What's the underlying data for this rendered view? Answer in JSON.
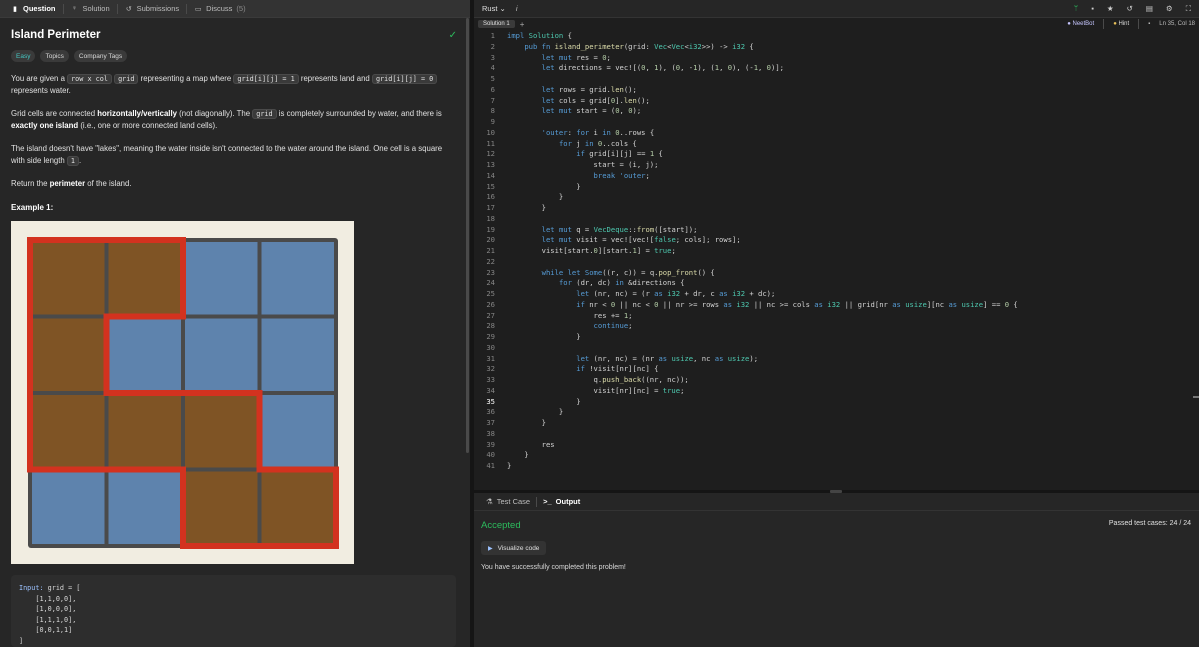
{
  "left_tabs": [
    {
      "label": "Question",
      "icon": "question-icon"
    },
    {
      "label": "Solution",
      "icon": "bulb-icon"
    },
    {
      "label": "Submissions",
      "icon": "history-icon"
    },
    {
      "label": "Discuss",
      "icon": "chat-icon",
      "count": "(5)"
    }
  ],
  "problem": {
    "title": "Island Perimeter",
    "tags": [
      "Easy",
      "Topics",
      "Company Tags"
    ],
    "p1_a": "You are given a ",
    "p1_code1": "row x col",
    "p1_b": " ",
    "p1_code2": "grid",
    "p1_c": " representing a map where ",
    "p1_code3": "grid[i][j] = 1",
    "p1_d": " represents land and ",
    "p1_code4": "grid[i][j] = 0",
    "p1_e": " represents water.",
    "p2_a": "Grid cells are connected ",
    "p2_b": "horizontally/vertically",
    "p2_c": " (not diagonally). The ",
    "p2_code": "grid",
    "p2_d": " is completely surrounded by water, and there is ",
    "p2_e": "exactly one island",
    "p2_f": " (i.e., one or more connected land cells).",
    "p3_a": "The island doesn't have \"lakes\", meaning the water inside isn't connected to the water around the island. One cell is a square with side length ",
    "p3_code": "1",
    "p3_b": ".",
    "p4_a": "Return the ",
    "p4_b": "perimeter",
    "p4_c": " of the island.",
    "example_title": "Example 1:",
    "grid": [
      [
        1,
        1,
        0,
        0
      ],
      [
        1,
        0,
        0,
        0
      ],
      [
        1,
        1,
        1,
        0
      ],
      [
        0,
        0,
        1,
        1
      ]
    ],
    "input_label": "Input:",
    "input_text": " grid = [\n    [1,1,0,0],\n    [1,0,0,0],\n    [1,1,1,0],\n    [0,0,1,1]\n]"
  },
  "colors": {
    "land": "#7f5425",
    "water": "#5e83ad",
    "border": "#d3321f",
    "grid_line": "#4a4a4a",
    "accepted": "#2cbb5d"
  },
  "editor": {
    "language": "Rust",
    "info_icon": "i",
    "file_tab": "Solution 1",
    "neetbot": "NeetBot",
    "hint": "Hint",
    "cursor": "Ln 35, Col 18",
    "current_line": 35,
    "lines": [
      "impl Solution {",
      "    pub fn island_perimeter(grid: Vec<Vec<i32>>) -> i32 {",
      "        let mut res = 0;",
      "        let directions = vec![(0, 1), (0, -1), (1, 0), (-1, 0)];",
      "",
      "        let rows = grid.len();",
      "        let cols = grid[0].len();",
      "        let mut start = (0, 0);",
      "",
      "        'outer: for i in 0..rows {",
      "            for j in 0..cols {",
      "                if grid[i][j] == 1 {",
      "                    start = (i, j);",
      "                    break 'outer;",
      "                }",
      "            }",
      "        }",
      "",
      "        let mut q = VecDeque::from([start]);",
      "        let mut visit = vec![vec![false; cols]; rows];",
      "        visit[start.0][start.1] = true;",
      "",
      "        while let Some((r, c)) = q.pop_front() {",
      "            for (dr, dc) in &directions {",
      "                let (nr, nc) = (r as i32 + dr, c as i32 + dc);",
      "                if nr < 0 || nc < 0 || nr >= rows as i32 || nc >= cols as i32 || grid[nr as usize][nc as usize] == 0 {",
      "                    res += 1;",
      "                    continue;",
      "                }",
      "",
      "                let (nr, nc) = (nr as usize, nc as usize);",
      "                if !visit[nr][nc] {",
      "                    q.push_back((nr, nc));",
      "                    visit[nr][nc] = true;",
      "                }",
      "            }",
      "        }",
      "",
      "        res",
      "    }",
      "}"
    ]
  },
  "bottom": {
    "tabs": [
      {
        "label": "Test Case",
        "icon": "flask-icon"
      },
      {
        "label": "Output",
        "icon": "terminal-icon"
      }
    ],
    "status": "Accepted",
    "passed": "Passed test cases: 24 / 24",
    "visualize": "Visualize code",
    "message": "You have successfully completed this problem!"
  }
}
